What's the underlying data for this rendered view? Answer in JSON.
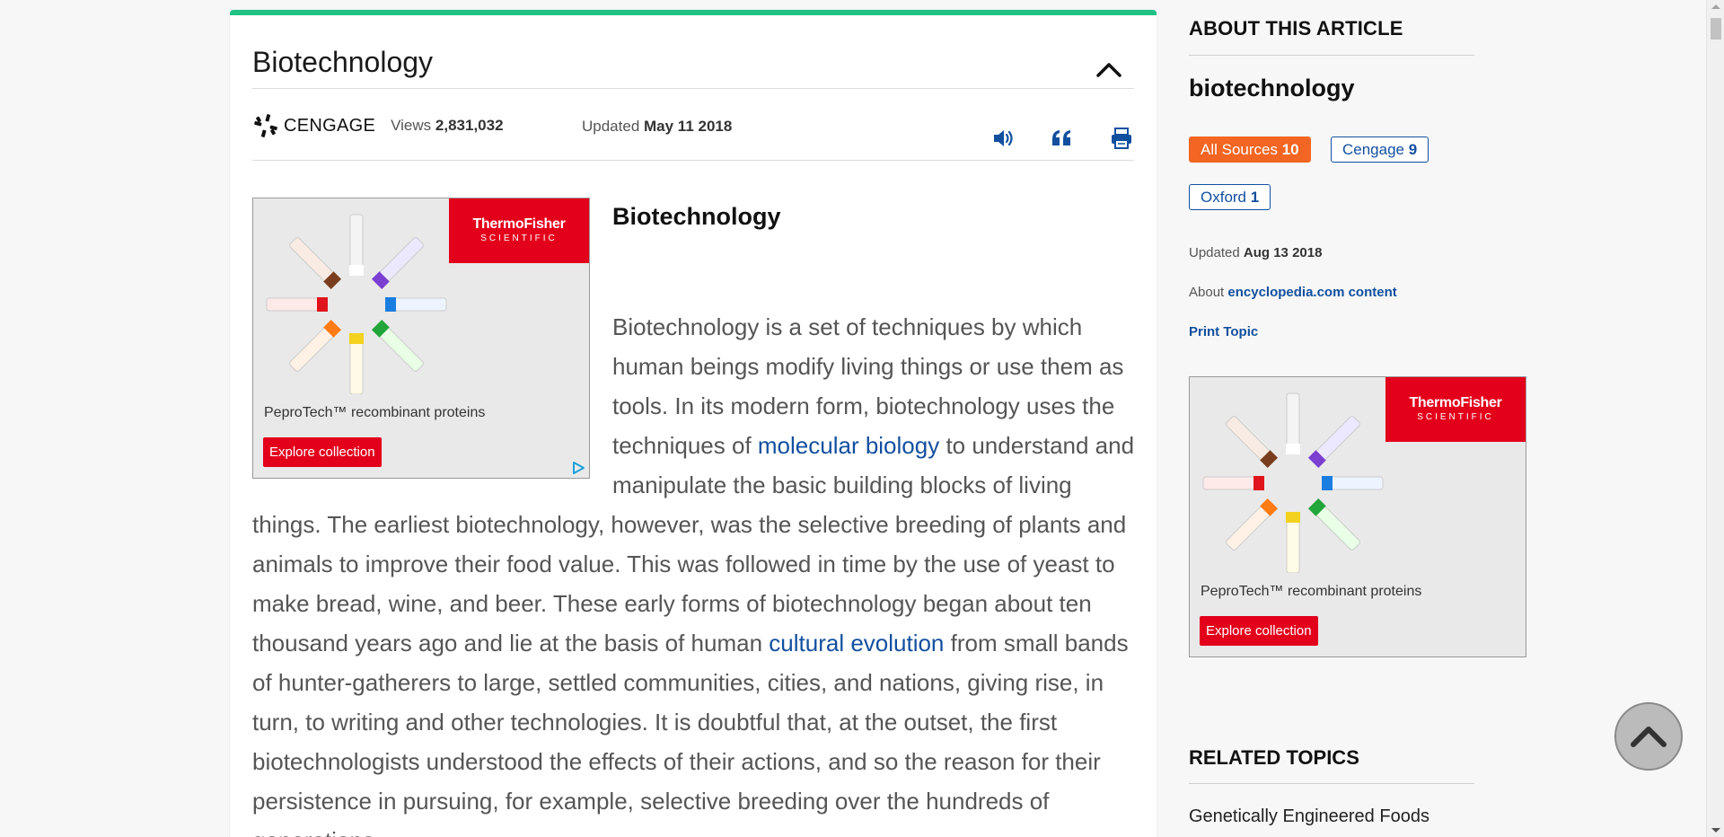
{
  "article": {
    "card_title": "Biotechnology",
    "source": "CENGAGE",
    "views_label": "Views",
    "views_value": "2,831,032",
    "updated_label": "Updated",
    "updated_value": "May 11 2018",
    "heading": "Biotechnology",
    "body": {
      "p1": "Biotechnology is a set of techniques by which human beings modify living things or use them as tools. In its modern form, biotechnology uses the techniques of ",
      "link1": "molecular biology",
      "p2": " to understand and manipulate the basic building blocks of living things. The earliest biotechnology, however, was the selective breeding of plants and animals to improve their food value. This was followed in time by the use of yeast to make bread, wine, and beer. These early forms of biotechnology began about ten thousand years ago and lie at the basis of human ",
      "link2": "cultural evolution",
      "p3": " from small bands of hunter-gatherers to large, settled communities, cities, and nations, giving rise, in turn, to writing and other technologies. It is doubtful that, at the outset, the first biotechnologists understood the effects of their actions, and so the reason for their persistence in pursuing, for example, selective breeding over the hundreds of generations"
    },
    "tools": {
      "listen_icon": "speaker-icon",
      "cite_icon": "quote-icon",
      "print_icon": "printer-icon"
    }
  },
  "ad": {
    "brand_line1": "ThermoFisher",
    "brand_line2": "SCIENTIFIC",
    "caption": "PeproTech™ recombinant proteins",
    "button": "Explore collection"
  },
  "sidebar": {
    "heading": "ABOUT THIS ARTICLE",
    "title": "biotechnology",
    "sources": [
      {
        "label": "All Sources",
        "count": "10",
        "active": true
      },
      {
        "label": "Cengage",
        "count": "9",
        "active": false
      },
      {
        "label": "Oxford",
        "count": "1",
        "active": false
      }
    ],
    "updated_label": "Updated",
    "updated_value": "Aug 13 2018",
    "about_label": "About",
    "about_link": "encyclopedia.com content",
    "print_topic": "Print Topic",
    "related_heading": "RELATED TOPICS",
    "related": [
      "Genetically Engineered Foods"
    ]
  },
  "colors": {
    "accent_green": "#1fc185",
    "link_blue": "#124f9f",
    "active_chip": "#f26522",
    "ad_red": "#e3001b"
  }
}
